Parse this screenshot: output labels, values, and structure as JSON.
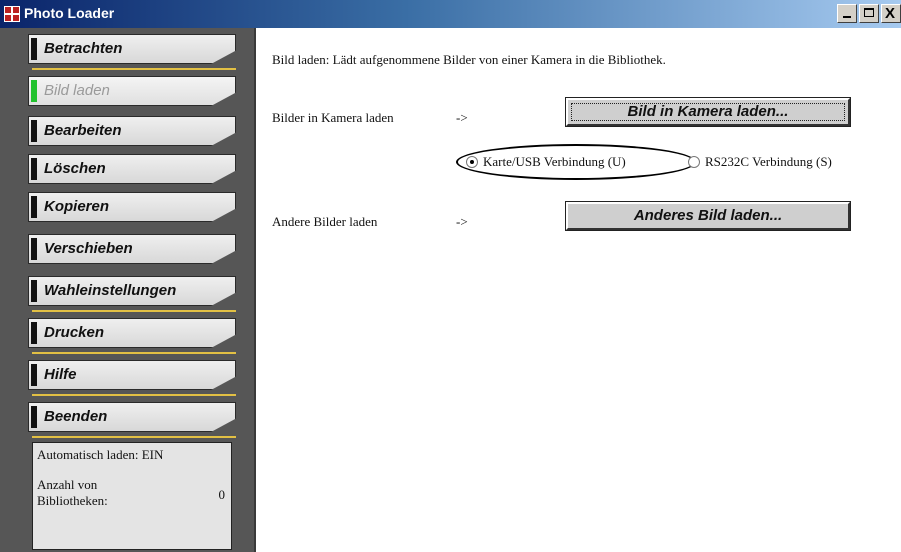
{
  "window": {
    "title": "Photo Loader",
    "minimize_glyph": "_",
    "maximize_glyph": "□",
    "close_glyph": "X"
  },
  "sidebar": {
    "items": [
      {
        "label": "Betrachten",
        "active": false
      },
      {
        "label": "Bild laden",
        "active": true
      },
      {
        "label": "Bearbeiten",
        "active": false
      },
      {
        "label": "Löschen",
        "active": false
      },
      {
        "label": "Kopieren",
        "active": false
      },
      {
        "label": "Verschieben",
        "active": false
      },
      {
        "label": "Wahleinstellungen",
        "active": false
      },
      {
        "label": "Drucken",
        "active": false
      },
      {
        "label": "Hilfe",
        "active": false
      },
      {
        "label": "Beenden",
        "active": false
      }
    ],
    "info": {
      "auto_load": "Automatisch laden: EIN",
      "library_count_label": "Anzahl von Bibliotheken:",
      "library_count_value": "0"
    }
  },
  "main": {
    "description": "Bild laden: Lädt aufgenommene Bilder von einer Kamera in die Bibliothek.",
    "camera_row": {
      "label": "Bilder in Kamera laden",
      "arrow": "->",
      "button": "Bild in Kamera laden..."
    },
    "connection": {
      "options": [
        {
          "label": "Karte/USB Verbindung (U)",
          "checked": true
        },
        {
          "label": "RS232C Verbindung (S)",
          "checked": false
        }
      ]
    },
    "other_row": {
      "label": "Andere Bilder laden",
      "arrow": "->",
      "button": "Anderes Bild laden..."
    }
  },
  "colors": {
    "titlebar_start": "#0a246a",
    "sidebar_bg": "#565656",
    "separator": "#e2c044",
    "active_marker": "#22c22e"
  }
}
